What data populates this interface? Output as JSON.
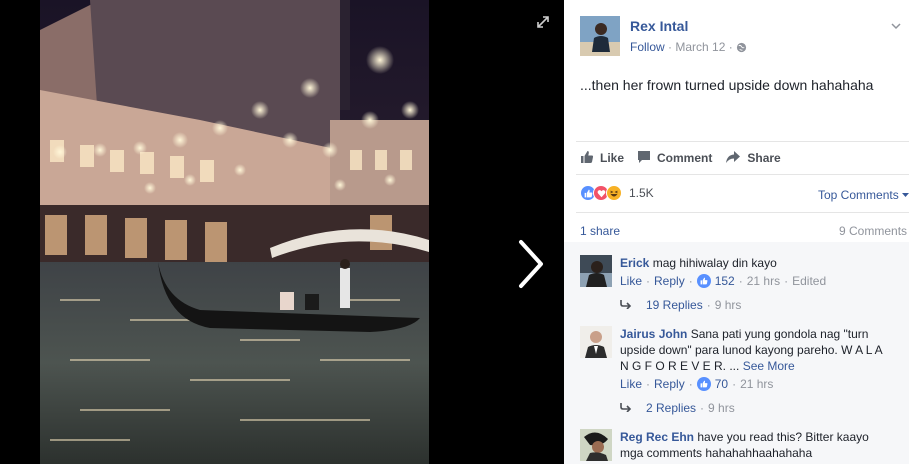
{
  "post": {
    "author": "Rex Intal",
    "follow": "Follow",
    "date": "March 12",
    "text": "...then her frown turned upside down hahahaha"
  },
  "actions": {
    "like": "Like",
    "comment": "Comment",
    "share": "Share"
  },
  "stats": {
    "reaction_count": "1.5K",
    "top_comments": "Top Comments",
    "shares": "1 share",
    "comments": "9 Comments"
  },
  "comments": [
    {
      "name": "Erick",
      "text": "mag hihiwalay din kayo",
      "like": "Like",
      "reply": "Reply",
      "likes": "152",
      "time": "21 hrs",
      "edited": "Edited",
      "replies": "19 Replies",
      "replies_time": "9 hrs"
    },
    {
      "name": "Jairus John",
      "text": "Sana pati yung gondola nag \"turn upside down\" para lunod kayong pareho. W A L A N G F O R E V E R. ...",
      "see_more": "See More",
      "like": "Like",
      "reply": "Reply",
      "likes": "70",
      "time": "21 hrs",
      "replies": "2 Replies",
      "replies_time": "9 hrs"
    },
    {
      "name": "Reg Rec Ehn",
      "text": "have you read this? Bitter kaayo mga comments hahahahhaahahaha"
    }
  ],
  "colors": {
    "link": "#365899",
    "like_blue": "#5890ff",
    "love_red": "#f25268",
    "haha_yellow": "#f7b125",
    "comments_bg": "#f6f7f9"
  },
  "icons": [
    "expand-icon",
    "next-arrow-icon",
    "chevron-down-icon",
    "globe-icon",
    "like-icon",
    "comment-icon",
    "share-icon",
    "reply-arrow-icon"
  ]
}
